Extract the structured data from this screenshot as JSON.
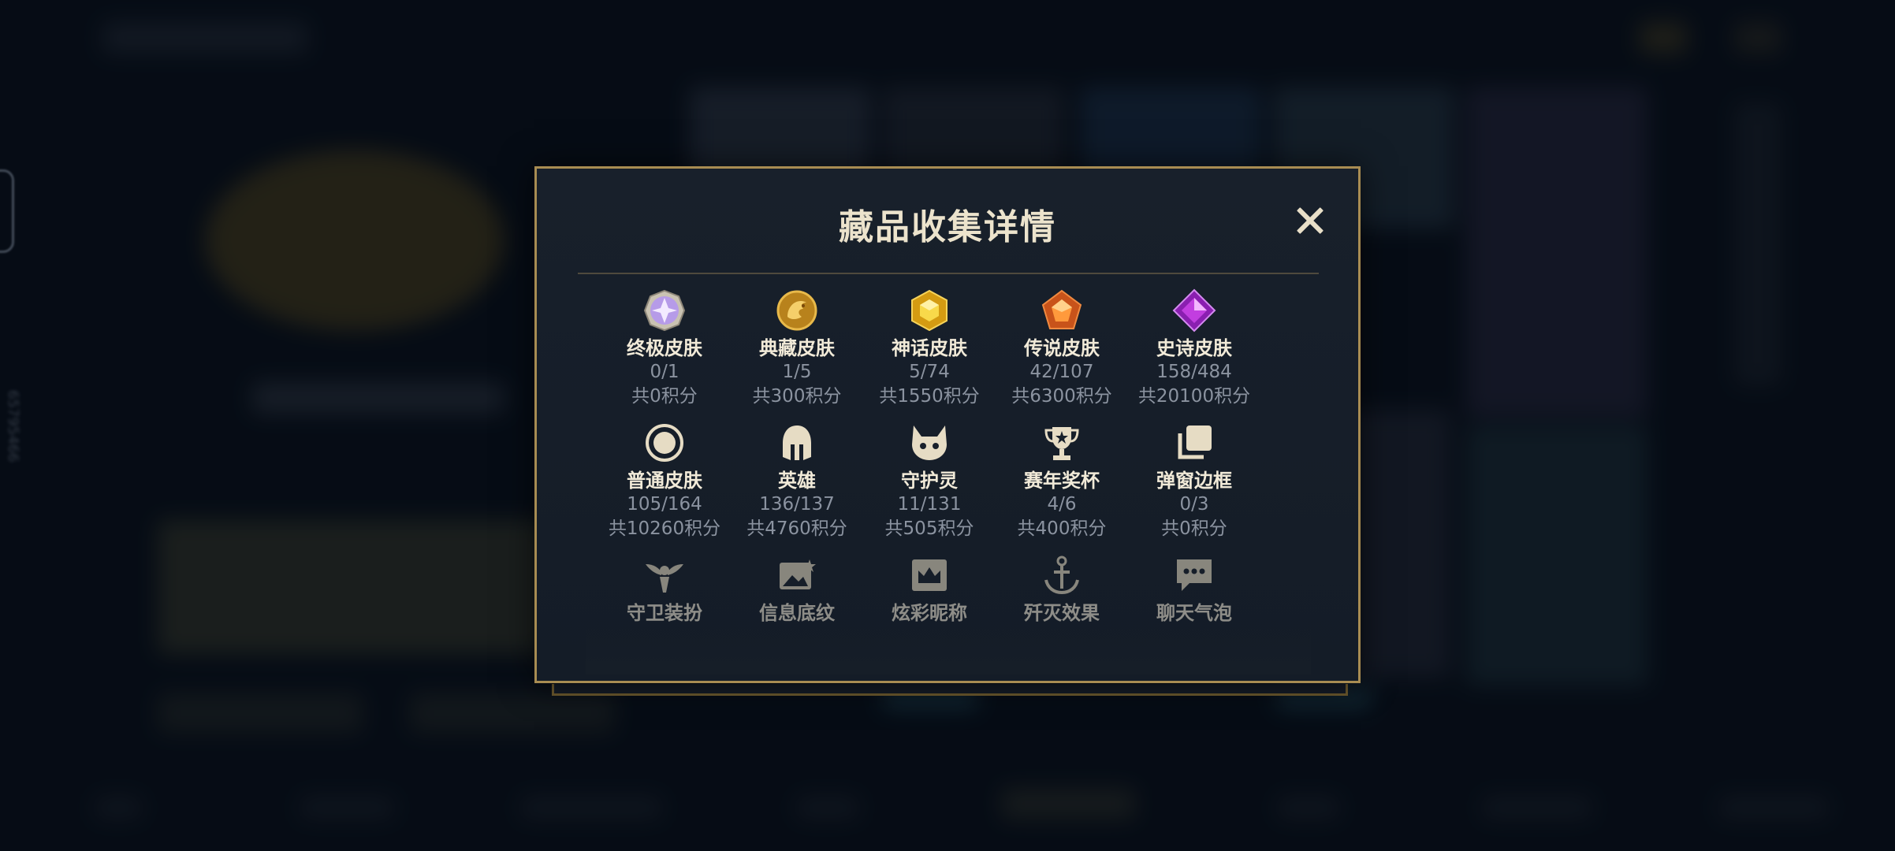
{
  "modal": {
    "title": "藏品收集详情",
    "close_icon": "close-icon"
  },
  "background": {
    "side_id": "65795466"
  },
  "items": [
    {
      "icon": "ultimate-skin-icon",
      "name": "终极皮肤",
      "count": "0/1",
      "points": "共0积分"
    },
    {
      "icon": "prestige-skin-icon",
      "name": "典藏皮肤",
      "count": "1/5",
      "points": "共300积分"
    },
    {
      "icon": "mythic-skin-icon",
      "name": "神话皮肤",
      "count": "5/74",
      "points": "共1550积分"
    },
    {
      "icon": "legendary-skin-icon",
      "name": "传说皮肤",
      "count": "42/107",
      "points": "共6300积分"
    },
    {
      "icon": "epic-skin-icon",
      "name": "史诗皮肤",
      "count": "158/484",
      "points": "共20100积分"
    },
    {
      "icon": "standard-skin-icon",
      "name": "普通皮肤",
      "count": "105/164",
      "points": "共10260积分"
    },
    {
      "icon": "champion-helmet-icon",
      "name": "英雄",
      "count": "136/137",
      "points": "共4760积分"
    },
    {
      "icon": "little-legend-icon",
      "name": "守护灵",
      "count": "11/131",
      "points": "共505积分"
    },
    {
      "icon": "trophy-icon",
      "name": "赛年奖杯",
      "count": "4/6",
      "points": "共400积分"
    },
    {
      "icon": "frame-stack-icon",
      "name": "弹窗边框",
      "count": "0/3",
      "points": "共0积分"
    },
    {
      "icon": "ward-skin-icon",
      "name": "守卫装扮",
      "count": "",
      "points": ""
    },
    {
      "icon": "banner-image-icon",
      "name": "信息底纹",
      "count": "",
      "points": ""
    },
    {
      "icon": "nameplate-crown-icon",
      "name": "炫彩昵称",
      "count": "",
      "points": ""
    },
    {
      "icon": "anchor-effect-icon",
      "name": "歼灭效果",
      "count": "",
      "points": ""
    },
    {
      "icon": "chat-bubble-icon",
      "name": "聊天气泡",
      "count": "",
      "points": ""
    }
  ],
  "colors": {
    "modal_border": "#a88c52",
    "title_text": "#ece3cc",
    "muted_text": "#8b93a0",
    "icon_gold": "#c9a96e"
  }
}
